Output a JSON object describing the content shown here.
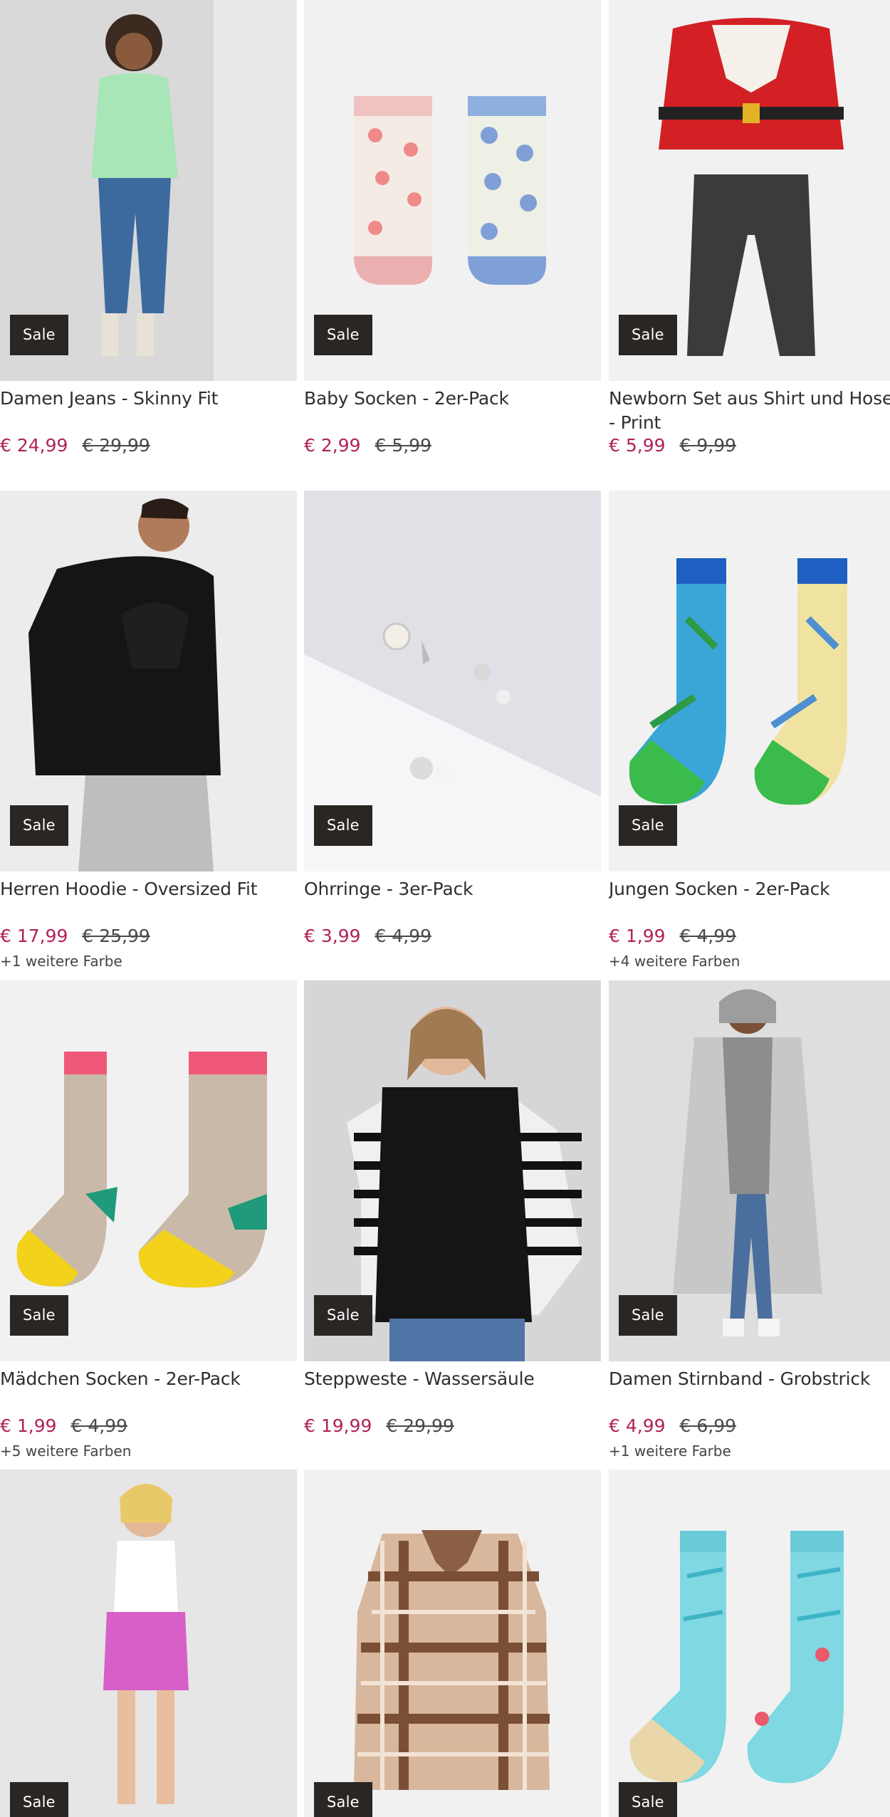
{
  "products": [
    {
      "name": "Damen Jeans - Skinny Fit",
      "price": "€ 24,99",
      "old_price": "€ 29,99",
      "badge": "Sale",
      "colors": ""
    },
    {
      "name": "Baby Socken - 2er-Pack",
      "price": "€ 2,99",
      "old_price": "€ 5,99",
      "badge": "Sale",
      "colors": ""
    },
    {
      "name": "Newborn Set aus Shirt und Hose - Print",
      "price": "€ 5,99",
      "old_price": "€ 9,99",
      "badge": "Sale",
      "colors": ""
    },
    {
      "name": "Herren Hoodie - Oversized Fit",
      "price": "€ 17,99",
      "old_price": "€ 25,99",
      "badge": "Sale",
      "colors": "+1 weitere Farbe"
    },
    {
      "name": "Ohrringe - 3er-Pack",
      "price": "€ 3,99",
      "old_price": "€ 4,99",
      "badge": "Sale",
      "colors": ""
    },
    {
      "name": "Jungen Socken - 2er-Pack",
      "price": "€ 1,99",
      "old_price": "€ 4,99",
      "badge": "Sale",
      "colors": "+4 weitere Farben"
    },
    {
      "name": "Mädchen Socken - 2er-Pack",
      "price": "€ 1,99",
      "old_price": "€ 4,99",
      "badge": "Sale",
      "colors": "+5 weitere Farben"
    },
    {
      "name": "Steppweste - Wassersäule",
      "price": "€ 19,99",
      "old_price": "€ 29,99",
      "badge": "Sale",
      "colors": ""
    },
    {
      "name": "Damen Stirnband - Grobstrick",
      "price": "€ 4,99",
      "old_price": "€ 6,99",
      "badge": "Sale",
      "colors": "+1 weitere Farbe"
    },
    {
      "badge": "Sale"
    },
    {
      "badge": "Sale"
    },
    {
      "badge": "Sale"
    }
  ],
  "colors": {
    "price": "#b0225a",
    "badge_bg": "#2a2624"
  }
}
